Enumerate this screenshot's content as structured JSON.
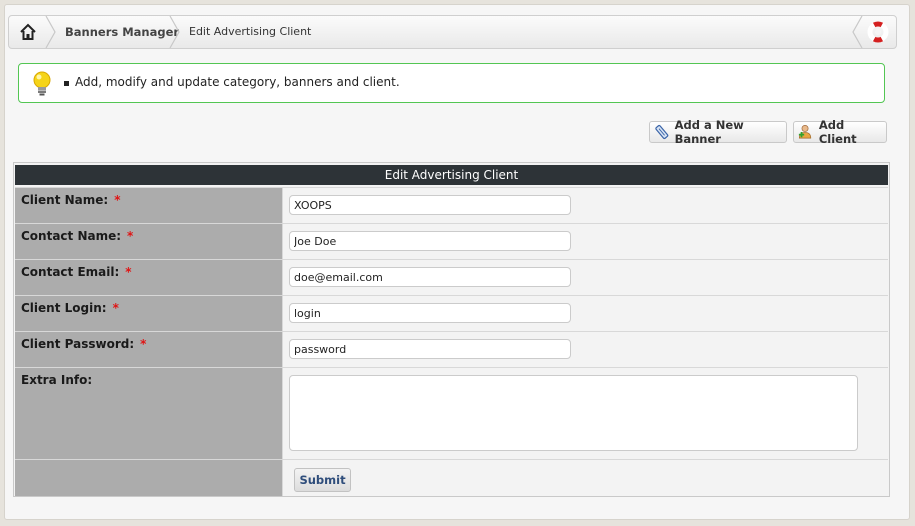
{
  "breadcrumb": {
    "items": [
      "Banners Manager",
      "Edit Advertising Client"
    ]
  },
  "icons": {
    "home": "home-icon",
    "help": "lifebuoy-icon",
    "tip": "lightbulb-icon",
    "add_banner": "banner-icon",
    "add_client": "add-user-icon"
  },
  "tip": {
    "text": "Add, modify and update category, banners and client."
  },
  "actions": {
    "add_banner": "Add a New Banner",
    "add_client": "Add Client"
  },
  "form": {
    "title": "Edit Advertising Client",
    "required_mark": "*",
    "fields": [
      {
        "label": "Client Name:",
        "value": "XOOPS",
        "required": true
      },
      {
        "label": "Contact Name:",
        "value": "Joe Doe",
        "required": true
      },
      {
        "label": "Contact Email:",
        "value": "doe@email.com",
        "required": true
      },
      {
        "label": "Client Login:",
        "value": "login",
        "required": true
      },
      {
        "label": "Client Password:",
        "value": "password",
        "required": true
      },
      {
        "label": "Extra Info:",
        "value": "",
        "required": false
      }
    ],
    "submit_label": "Submit"
  },
  "colors": {
    "header_bg": "#2d3337",
    "label_bg": "#acacac",
    "tip_border": "#53c653",
    "required": "#e01414"
  }
}
